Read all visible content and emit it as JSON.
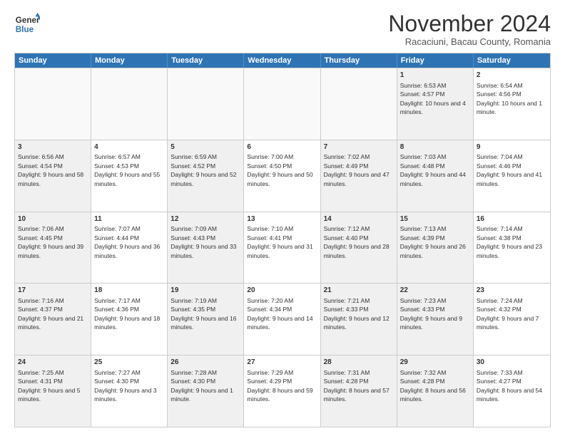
{
  "logo": {
    "general": "General",
    "blue": "Blue"
  },
  "header": {
    "month": "November 2024",
    "location": "Racaciuni, Bacau County, Romania"
  },
  "days": [
    "Sunday",
    "Monday",
    "Tuesday",
    "Wednesday",
    "Thursday",
    "Friday",
    "Saturday"
  ],
  "rows": [
    [
      {
        "day": "",
        "empty": true
      },
      {
        "day": "",
        "empty": true
      },
      {
        "day": "",
        "empty": true
      },
      {
        "day": "",
        "empty": true
      },
      {
        "day": "",
        "empty": true
      },
      {
        "day": "1",
        "sunrise": "Sunrise: 6:53 AM",
        "sunset": "Sunset: 4:57 PM",
        "daylight": "Daylight: 10 hours and 4 minutes.",
        "shaded": true
      },
      {
        "day": "2",
        "sunrise": "Sunrise: 6:54 AM",
        "sunset": "Sunset: 4:56 PM",
        "daylight": "Daylight: 10 hours and 1 minute.",
        "shaded": false
      }
    ],
    [
      {
        "day": "3",
        "sunrise": "Sunrise: 6:56 AM",
        "sunset": "Sunset: 4:54 PM",
        "daylight": "Daylight: 9 hours and 58 minutes.",
        "shaded": true
      },
      {
        "day": "4",
        "sunrise": "Sunrise: 6:57 AM",
        "sunset": "Sunset: 4:53 PM",
        "daylight": "Daylight: 9 hours and 55 minutes.",
        "shaded": false
      },
      {
        "day": "5",
        "sunrise": "Sunrise: 6:59 AM",
        "sunset": "Sunset: 4:52 PM",
        "daylight": "Daylight: 9 hours and 52 minutes.",
        "shaded": true
      },
      {
        "day": "6",
        "sunrise": "Sunrise: 7:00 AM",
        "sunset": "Sunset: 4:50 PM",
        "daylight": "Daylight: 9 hours and 50 minutes.",
        "shaded": false
      },
      {
        "day": "7",
        "sunrise": "Sunrise: 7:02 AM",
        "sunset": "Sunset: 4:49 PM",
        "daylight": "Daylight: 9 hours and 47 minutes.",
        "shaded": true
      },
      {
        "day": "8",
        "sunrise": "Sunrise: 7:03 AM",
        "sunset": "Sunset: 4:48 PM",
        "daylight": "Daylight: 9 hours and 44 minutes.",
        "shaded": true
      },
      {
        "day": "9",
        "sunrise": "Sunrise: 7:04 AM",
        "sunset": "Sunset: 4:46 PM",
        "daylight": "Daylight: 9 hours and 41 minutes.",
        "shaded": false
      }
    ],
    [
      {
        "day": "10",
        "sunrise": "Sunrise: 7:06 AM",
        "sunset": "Sunset: 4:45 PM",
        "daylight": "Daylight: 9 hours and 39 minutes.",
        "shaded": true
      },
      {
        "day": "11",
        "sunrise": "Sunrise: 7:07 AM",
        "sunset": "Sunset: 4:44 PM",
        "daylight": "Daylight: 9 hours and 36 minutes.",
        "shaded": false
      },
      {
        "day": "12",
        "sunrise": "Sunrise: 7:09 AM",
        "sunset": "Sunset: 4:43 PM",
        "daylight": "Daylight: 9 hours and 33 minutes.",
        "shaded": true
      },
      {
        "day": "13",
        "sunrise": "Sunrise: 7:10 AM",
        "sunset": "Sunset: 4:41 PM",
        "daylight": "Daylight: 9 hours and 31 minutes.",
        "shaded": false
      },
      {
        "day": "14",
        "sunrise": "Sunrise: 7:12 AM",
        "sunset": "Sunset: 4:40 PM",
        "daylight": "Daylight: 9 hours and 28 minutes.",
        "shaded": true
      },
      {
        "day": "15",
        "sunrise": "Sunrise: 7:13 AM",
        "sunset": "Sunset: 4:39 PM",
        "daylight": "Daylight: 9 hours and 26 minutes.",
        "shaded": true
      },
      {
        "day": "16",
        "sunrise": "Sunrise: 7:14 AM",
        "sunset": "Sunset: 4:38 PM",
        "daylight": "Daylight: 9 hours and 23 minutes.",
        "shaded": false
      }
    ],
    [
      {
        "day": "17",
        "sunrise": "Sunrise: 7:16 AM",
        "sunset": "Sunset: 4:37 PM",
        "daylight": "Daylight: 9 hours and 21 minutes.",
        "shaded": true
      },
      {
        "day": "18",
        "sunrise": "Sunrise: 7:17 AM",
        "sunset": "Sunset: 4:36 PM",
        "daylight": "Daylight: 9 hours and 18 minutes.",
        "shaded": false
      },
      {
        "day": "19",
        "sunrise": "Sunrise: 7:19 AM",
        "sunset": "Sunset: 4:35 PM",
        "daylight": "Daylight: 9 hours and 16 minutes.",
        "shaded": true
      },
      {
        "day": "20",
        "sunrise": "Sunrise: 7:20 AM",
        "sunset": "Sunset: 4:34 PM",
        "daylight": "Daylight: 9 hours and 14 minutes.",
        "shaded": false
      },
      {
        "day": "21",
        "sunrise": "Sunrise: 7:21 AM",
        "sunset": "Sunset: 4:33 PM",
        "daylight": "Daylight: 9 hours and 12 minutes.",
        "shaded": true
      },
      {
        "day": "22",
        "sunrise": "Sunrise: 7:23 AM",
        "sunset": "Sunset: 4:33 PM",
        "daylight": "Daylight: 9 hours and 9 minutes.",
        "shaded": true
      },
      {
        "day": "23",
        "sunrise": "Sunrise: 7:24 AM",
        "sunset": "Sunset: 4:32 PM",
        "daylight": "Daylight: 9 hours and 7 minutes.",
        "shaded": false
      }
    ],
    [
      {
        "day": "24",
        "sunrise": "Sunrise: 7:25 AM",
        "sunset": "Sunset: 4:31 PM",
        "daylight": "Daylight: 9 hours and 5 minutes.",
        "shaded": true
      },
      {
        "day": "25",
        "sunrise": "Sunrise: 7:27 AM",
        "sunset": "Sunset: 4:30 PM",
        "daylight": "Daylight: 9 hours and 3 minutes.",
        "shaded": false
      },
      {
        "day": "26",
        "sunrise": "Sunrise: 7:28 AM",
        "sunset": "Sunset: 4:30 PM",
        "daylight": "Daylight: 9 hours and 1 minute.",
        "shaded": true
      },
      {
        "day": "27",
        "sunrise": "Sunrise: 7:29 AM",
        "sunset": "Sunset: 4:29 PM",
        "daylight": "Daylight: 8 hours and 59 minutes.",
        "shaded": false
      },
      {
        "day": "28",
        "sunrise": "Sunrise: 7:31 AM",
        "sunset": "Sunset: 4:28 PM",
        "daylight": "Daylight: 8 hours and 57 minutes.",
        "shaded": true
      },
      {
        "day": "29",
        "sunrise": "Sunrise: 7:32 AM",
        "sunset": "Sunset: 4:28 PM",
        "daylight": "Daylight: 8 hours and 56 minutes.",
        "shaded": true
      },
      {
        "day": "30",
        "sunrise": "Sunrise: 7:33 AM",
        "sunset": "Sunset: 4:27 PM",
        "daylight": "Daylight: 8 hours and 54 minutes.",
        "shaded": false
      }
    ]
  ]
}
